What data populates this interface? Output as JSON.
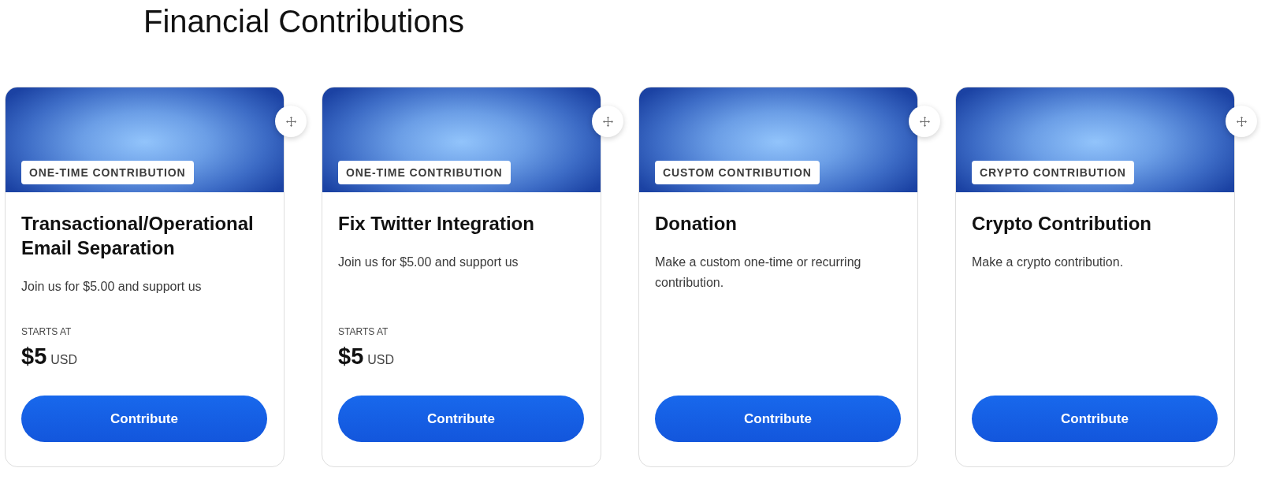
{
  "page": {
    "title": "Financial Contributions"
  },
  "cards": [
    {
      "tag": "ONE-TIME CONTRIBUTION",
      "title": "Transactional/Operational Email Separation",
      "description": "Join us for $5.00 and support us",
      "price": {
        "label": "STARTS AT",
        "amount": "$5",
        "currency": "USD"
      },
      "button": "Contribute"
    },
    {
      "tag": "ONE-TIME CONTRIBUTION",
      "title": "Fix Twitter Integration",
      "description": "Join us for $5.00 and support us",
      "price": {
        "label": "STARTS AT",
        "amount": "$5",
        "currency": "USD"
      },
      "button": "Contribute"
    },
    {
      "tag": "CUSTOM CONTRIBUTION",
      "title": "Donation",
      "description": "Make a custom one-time or recurring contribution.",
      "button": "Contribute"
    },
    {
      "tag": "CRYPTO CONTRIBUTION",
      "title": "Crypto Contribution",
      "description": "Make a crypto contribution.",
      "button": "Contribute"
    }
  ]
}
